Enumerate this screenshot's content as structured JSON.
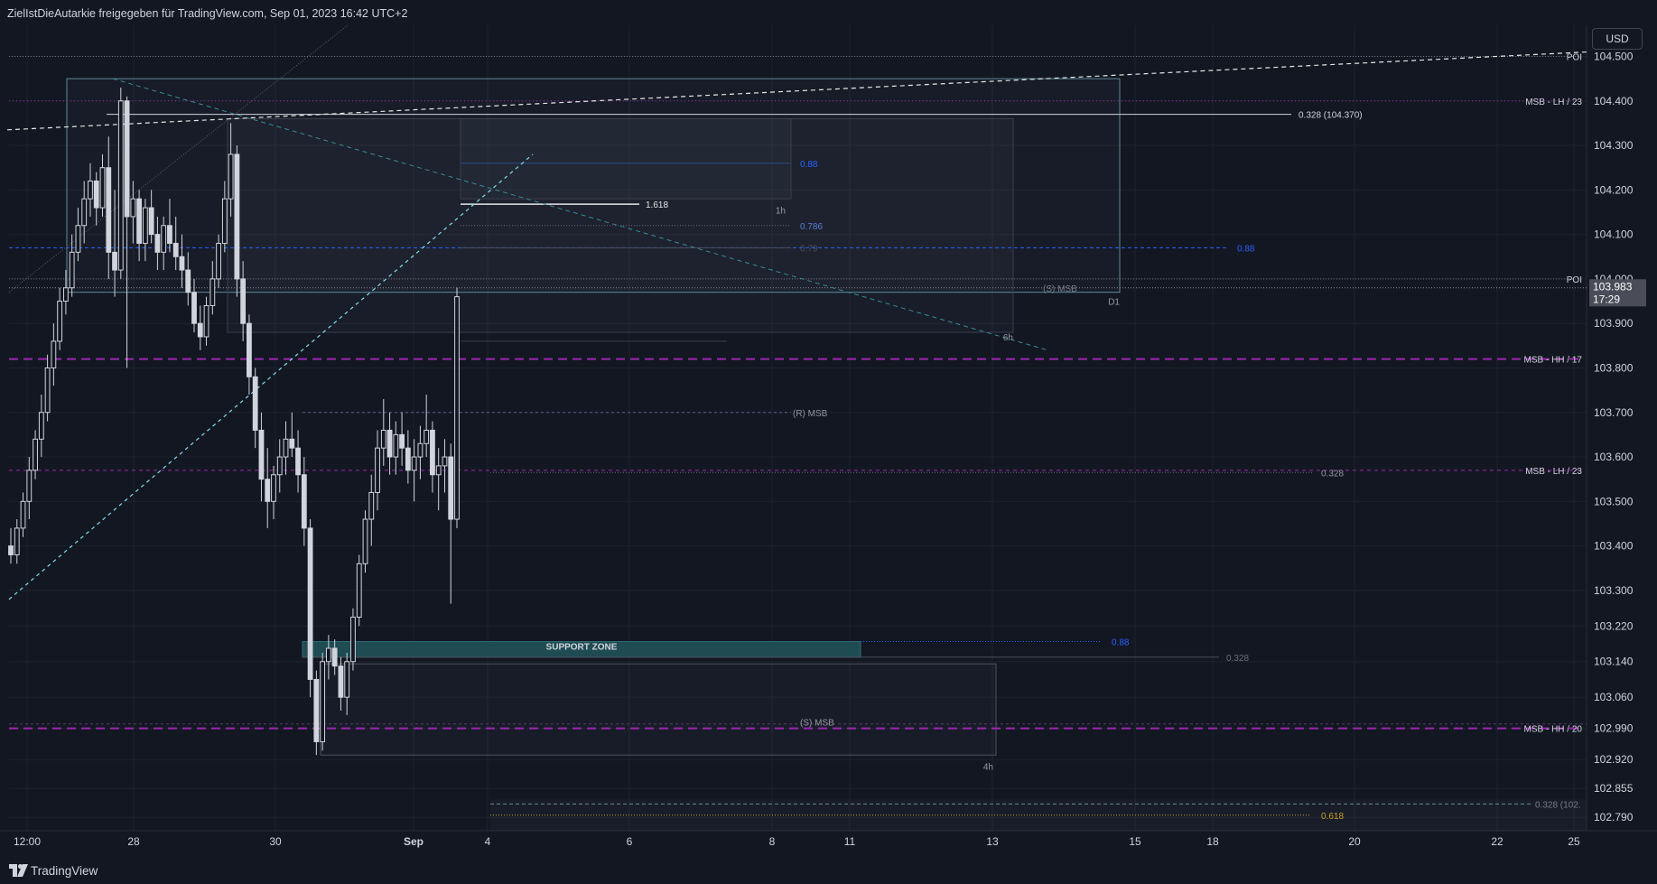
{
  "header": {
    "title": "ZielIstDieAutarkie freigegeben für TradingView.com, Sep 01, 2023 16:42 UTC+2",
    "currency": "USD"
  },
  "footer": {
    "brand": "TradingView"
  },
  "colors": {
    "background": "#131722",
    "candle": "#d1d4dc",
    "msb_line": "#9c27b0",
    "fib_blue": "#2962ff",
    "cyan": "#80deea",
    "support": "#1f4b52",
    "price_tag": "#4a4d57"
  },
  "chart_data": {
    "type": "candlestick",
    "y_axis": {
      "range": [
        102.76,
        104.57
      ],
      "ticks": [
        "104.500",
        "104.400",
        "104.300",
        "104.200",
        "104.100",
        "104.000",
        "103.900",
        "103.800",
        "103.700",
        "103.600",
        "103.500",
        "103.400",
        "103.300",
        "103.220",
        "103.140",
        "103.060",
        "102.990",
        "102.920",
        "102.855",
        "102.790"
      ]
    },
    "x_axis": {
      "ticks": [
        "12:00",
        "28",
        "30",
        "Sep",
        "4",
        "6",
        "8",
        "11",
        "13",
        "15",
        "18",
        "20",
        "22",
        "25"
      ]
    },
    "current_price": {
      "value": "103.983",
      "countdown": "17:29"
    },
    "horizontal_levels": [
      {
        "price": 104.5,
        "label": "POI"
      },
      {
        "price": 104.4,
        "label": "MSB - LH / 23"
      },
      {
        "price": 104.0,
        "label": "POI"
      },
      {
        "price": 103.82,
        "label": "MSB - HH / 17"
      },
      {
        "price": 103.57,
        "label": "MSB - LH / 23"
      },
      {
        "price": 102.99,
        "label": "MSB - HH / 20"
      }
    ],
    "annotations": [
      {
        "text": "0.328 (104.370)",
        "price": 104.37
      },
      {
        "text": "0.88",
        "price": 104.26
      },
      {
        "text": "1.618",
        "price": 104.17
      },
      {
        "text": "1h",
        "price": 104.155
      },
      {
        "text": "0.786",
        "price": 104.12
      },
      {
        "text": "0.88",
        "price": 104.07
      },
      {
        "text": "0.79",
        "price": 104.07
      },
      {
        "text": "(S) MSB",
        "price": 103.98
      },
      {
        "text": "D1",
        "price": 103.95
      },
      {
        "text": "6h",
        "price": 103.87
      },
      {
        "text": "(R) MSB",
        "price": 103.7
      },
      {
        "text": "0.328",
        "price": 103.565
      },
      {
        "text": "0.88",
        "price": 103.185
      },
      {
        "text": "SUPPORT ZONE",
        "price": 103.175
      },
      {
        "text": "0.328",
        "price": 103.15
      },
      {
        "text": "(S) MSB",
        "price": 103.005
      },
      {
        "text": "4h",
        "price": 102.905
      },
      {
        "text": "0.328 (102.",
        "price": 102.82
      },
      {
        "text": "0.618",
        "price": 102.79
      }
    ],
    "candles": [
      [
        103.4,
        103.44,
        103.36,
        103.38
      ],
      [
        103.38,
        103.46,
        103.36,
        103.44
      ],
      [
        103.44,
        103.52,
        103.42,
        103.5
      ],
      [
        103.5,
        103.6,
        103.46,
        103.57
      ],
      [
        103.57,
        103.66,
        103.55,
        103.64
      ],
      [
        103.64,
        103.74,
        103.6,
        103.7
      ],
      [
        103.7,
        103.83,
        103.68,
        103.8
      ],
      [
        103.8,
        103.9,
        103.76,
        103.86
      ],
      [
        103.86,
        103.98,
        103.84,
        103.95
      ],
      [
        103.95,
        104.02,
        103.92,
        103.98
      ],
      [
        103.98,
        104.1,
        103.96,
        104.06
      ],
      [
        104.06,
        104.16,
        104.04,
        104.12
      ],
      [
        104.12,
        104.22,
        104.08,
        104.18
      ],
      [
        104.18,
        104.26,
        104.14,
        104.22
      ],
      [
        104.22,
        104.24,
        104.12,
        104.16
      ],
      [
        104.16,
        104.28,
        104.14,
        104.25
      ],
      [
        104.25,
        104.32,
        104.0,
        104.06
      ],
      [
        104.06,
        104.2,
        103.96,
        104.02
      ],
      [
        104.02,
        104.43,
        104.0,
        104.4
      ],
      [
        104.4,
        104.41,
        103.8,
        104.14
      ],
      [
        104.14,
        104.22,
        104.08,
        104.18
      ],
      [
        104.18,
        104.2,
        104.04,
        104.08
      ],
      [
        104.08,
        104.18,
        104.04,
        104.16
      ],
      [
        104.16,
        104.2,
        104.08,
        104.1
      ],
      [
        104.1,
        104.14,
        104.02,
        104.06
      ],
      [
        104.06,
        104.14,
        104.02,
        104.12
      ],
      [
        104.12,
        104.18,
        104.06,
        104.08
      ],
      [
        104.08,
        104.14,
        104.02,
        104.05
      ],
      [
        104.05,
        104.1,
        103.98,
        104.02
      ],
      [
        104.02,
        104.06,
        103.94,
        103.97
      ],
      [
        103.97,
        104.0,
        103.88,
        103.9
      ],
      [
        103.9,
        103.94,
        103.84,
        103.87
      ],
      [
        103.87,
        103.96,
        103.85,
        103.94
      ],
      [
        103.94,
        104.04,
        103.92,
        104.0
      ],
      [
        104.0,
        104.1,
        103.98,
        104.08
      ],
      [
        104.08,
        104.22,
        104.06,
        104.18
      ],
      [
        104.18,
        104.35,
        104.14,
        104.28
      ],
      [
        104.28,
        104.3,
        103.96,
        104.0
      ],
      [
        104.0,
        104.04,
        103.86,
        103.9
      ],
      [
        103.9,
        103.92,
        103.74,
        103.78
      ],
      [
        103.78,
        103.8,
        103.62,
        103.66
      ],
      [
        103.66,
        103.7,
        103.5,
        103.55
      ],
      [
        103.55,
        103.62,
        103.44,
        103.5
      ],
      [
        103.5,
        103.58,
        103.46,
        103.56
      ],
      [
        103.56,
        103.64,
        103.52,
        103.6
      ],
      [
        103.6,
        103.68,
        103.56,
        103.64
      ],
      [
        103.64,
        103.7,
        103.6,
        103.62
      ],
      [
        103.62,
        103.66,
        103.52,
        103.56
      ],
      [
        103.56,
        103.6,
        103.4,
        103.44
      ],
      [
        103.44,
        103.46,
        103.06,
        103.1
      ],
      [
        103.1,
        103.12,
        102.93,
        102.96
      ],
      [
        102.96,
        103.16,
        102.94,
        103.14
      ],
      [
        103.14,
        103.2,
        103.1,
        103.17
      ],
      [
        103.17,
        103.19,
        103.11,
        103.13
      ],
      [
        103.13,
        103.15,
        103.03,
        103.06
      ],
      [
        103.06,
        103.16,
        103.02,
        103.14
      ],
      [
        103.14,
        103.26,
        103.12,
        103.24
      ],
      [
        103.24,
        103.38,
        103.22,
        103.36
      ],
      [
        103.36,
        103.48,
        103.34,
        103.46
      ],
      [
        103.46,
        103.56,
        103.4,
        103.52
      ],
      [
        103.52,
        103.66,
        103.48,
        103.62
      ],
      [
        103.62,
        103.73,
        103.58,
        103.66
      ],
      [
        103.66,
        103.7,
        103.56,
        103.6
      ],
      [
        103.6,
        103.68,
        103.56,
        103.65
      ],
      [
        103.65,
        103.7,
        103.58,
        103.62
      ],
      [
        103.62,
        103.66,
        103.54,
        103.57
      ],
      [
        103.57,
        103.64,
        103.5,
        103.6
      ],
      [
        103.6,
        103.67,
        103.55,
        103.63
      ],
      [
        103.63,
        103.74,
        103.6,
        103.66
      ],
      [
        103.66,
        103.68,
        103.52,
        103.56
      ],
      [
        103.56,
        103.62,
        103.48,
        103.58
      ],
      [
        103.58,
        103.64,
        103.52,
        103.6
      ],
      [
        103.6,
        103.63,
        103.27,
        103.46
      ],
      [
        103.46,
        103.98,
        103.44,
        103.96
      ]
    ]
  }
}
